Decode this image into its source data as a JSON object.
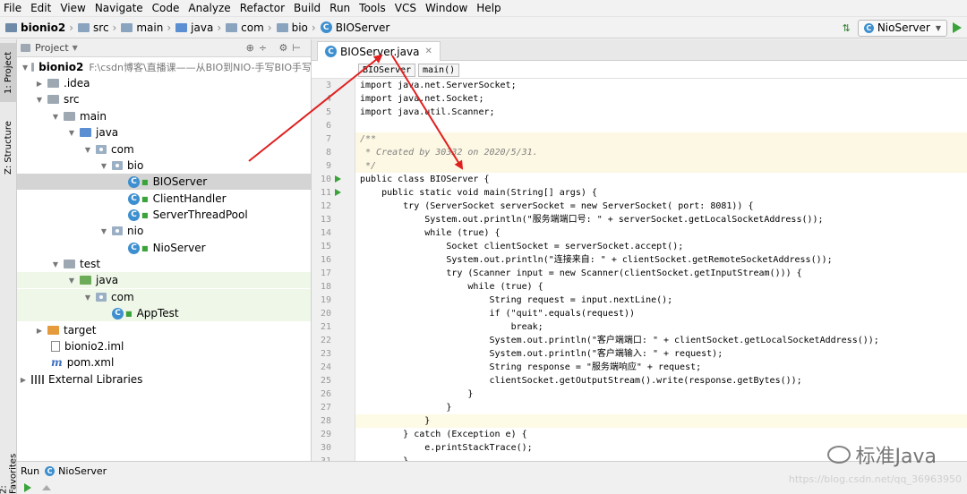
{
  "menu": [
    "File",
    "Edit",
    "View",
    "Navigate",
    "Code",
    "Analyze",
    "Refactor",
    "Build",
    "Run",
    "Tools",
    "VCS",
    "Window",
    "Help"
  ],
  "breadcrumb": [
    "bionio2",
    "src",
    "main",
    "java",
    "com",
    "bio",
    "BIOServer"
  ],
  "run_config": "NioServer",
  "side_tabs": {
    "project": "1: Project",
    "structure": "Z: Structure",
    "favorites": "2: Favorites"
  },
  "project_panel": {
    "title": "Project",
    "root_name": "bionio2",
    "root_path": "F:\\csdn博客\\直播课——从BIO到NIO-手写BIO手写",
    "items": [
      ".idea",
      "src",
      "main",
      "java",
      "com",
      "bio",
      "BIOServer",
      "ClientHandler",
      "ServerThreadPool",
      "nio",
      "NioServer",
      "test",
      "java",
      "com",
      "AppTest",
      "target",
      "bionio2.iml",
      "pom.xml",
      "External Libraries"
    ]
  },
  "editor": {
    "tab_title": "BIOServer.java",
    "crumbs": [
      "BIOServer",
      "main()"
    ],
    "line_numbers": [
      "3",
      "4",
      "5",
      "6",
      "7",
      "8",
      "9",
      "10",
      "11",
      "12",
      "13",
      "14",
      "15",
      "16",
      "17",
      "18",
      "19",
      "20",
      "21",
      "22",
      "23",
      "24",
      "25",
      "26",
      "27",
      "28",
      "29",
      "30",
      "31"
    ],
    "lines": [
      "import java.net.ServerSocket;",
      "import java.net.Socket;",
      "import java.util.Scanner;",
      "",
      "/**",
      " * Created by 30332 on 2020/5/31.",
      " */",
      "public class BIOServer {",
      "    public static void main(String[] args) {",
      "        try (ServerSocket serverSocket = new ServerSocket( port: 8081)) {",
      "            System.out.println(\"服务端端口号: \" + serverSocket.getLocalSocketAddress());",
      "            while (true) {",
      "                Socket clientSocket = serverSocket.accept();",
      "                System.out.println(\"连接来自: \" + clientSocket.getRemoteSocketAddress());",
      "                try (Scanner input = new Scanner(clientSocket.getInputStream())) {",
      "                    while (true) {",
      "                        String request = input.nextLine();",
      "                        if (\"quit\".equals(request))",
      "                            break;",
      "                        System.out.println(\"客户端端口: \" + clientSocket.getLocalSocketAddress());",
      "                        System.out.println(\"客户端输入: \" + request);",
      "                        String response = \"服务端响应\" + request;",
      "                        clientSocket.getOutputStream().write(response.getBytes());",
      "                    }",
      "                }",
      "            }",
      "        } catch (Exception e) {",
      "            e.printStackTrace();",
      "        }"
    ]
  },
  "run_panel": {
    "label": "Run",
    "config": "NioServer"
  },
  "watermark": {
    "brand": "标准Java",
    "url": "https://blog.csdn.net/qq_36963950"
  },
  "colors": {
    "annotation": "#e02020",
    "selection": "#d4d4d4",
    "keyword": "#000080",
    "string": "#008000"
  }
}
